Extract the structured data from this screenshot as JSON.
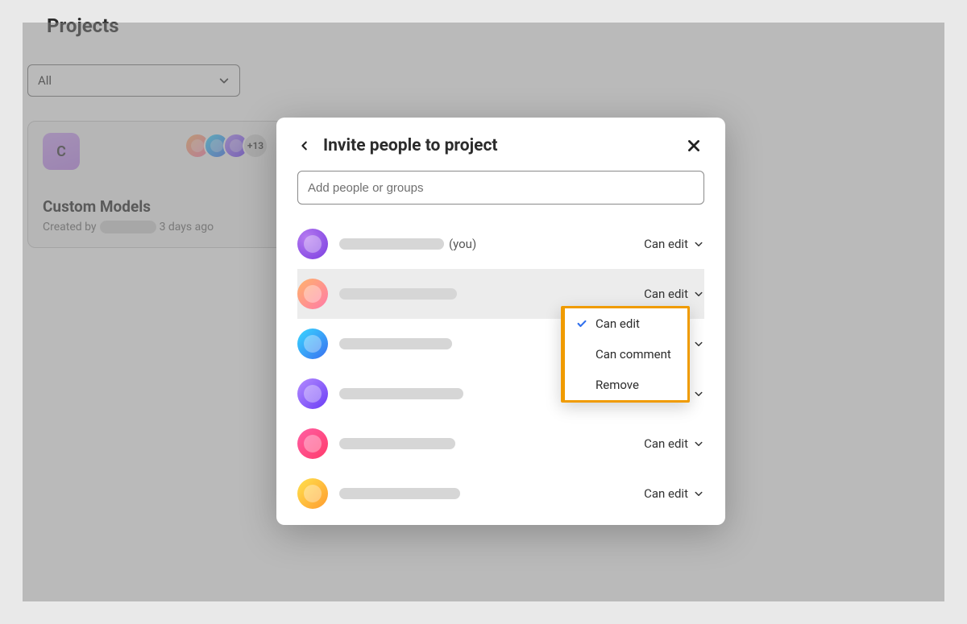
{
  "page": {
    "title": "Projects",
    "filter": {
      "label": "All"
    }
  },
  "card": {
    "thumb_letter": "C",
    "title": "Custom Models",
    "created_prefix": "Created by",
    "created_suffix": "3 days ago",
    "extra_avatars_badge": "+13"
  },
  "modal": {
    "title": "Invite people to project",
    "input_placeholder": "Add people or groups",
    "perm_default": "Can edit",
    "you_label": "(you)",
    "members": [
      {
        "avatar_class": "g1",
        "is_you": true,
        "highlight": false
      },
      {
        "avatar_class": "g2",
        "is_you": false,
        "highlight": true
      },
      {
        "avatar_class": "g3",
        "is_you": false,
        "highlight": false
      },
      {
        "avatar_class": "g4",
        "is_you": false,
        "highlight": false
      },
      {
        "avatar_class": "g5",
        "is_you": false,
        "highlight": false
      },
      {
        "avatar_class": "g6",
        "is_you": false,
        "highlight": false
      },
      {
        "avatar_class": "g7",
        "is_you": false,
        "highlight": false
      }
    ],
    "dropdown": {
      "items": [
        {
          "label": "Can edit",
          "selected": true
        },
        {
          "label": "Can comment",
          "selected": false
        },
        {
          "label": "Remove",
          "selected": false
        }
      ]
    }
  },
  "redact_widths": {
    "card_author": 70,
    "member_names": [
      130,
      146,
      140,
      154,
      144,
      150,
      168
    ]
  }
}
